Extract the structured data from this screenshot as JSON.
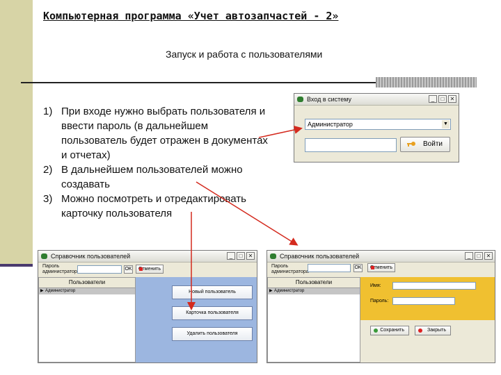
{
  "slide": {
    "title": "Компьютерная программа «Учет автозапчастей - 2»",
    "subtitle": "Запуск и работа с пользователями",
    "steps": [
      {
        "num": "1)",
        "text": "При входе нужно выбрать пользователя и ввести пароль (в дальнейшем пользователь будет отражен в документах и отчетах)"
      },
      {
        "num": "2)",
        "text": "В дальнейшем пользователей можно создавать"
      },
      {
        "num": "3)",
        "text": "Можно посмотреть и отредактировать карточку пользователя"
      }
    ]
  },
  "login_window": {
    "title": "Вход в систему",
    "user_combo_value": "Администратор",
    "enter_label": "Войти"
  },
  "window_controls": {
    "minimize": "_",
    "maximize": "□",
    "close": "✕"
  },
  "users_window_left": {
    "title": "Справочник пользователей",
    "password_label_1": "Пароль",
    "password_label_2": "администратора",
    "ok_label": "OK",
    "cancel_label": "Отменить",
    "list_header": "Пользователи",
    "row_1": "Администратор",
    "new_user_label": "Новый пользователь",
    "user_card_label": "Карточка пользователя",
    "delete_user_label": "Удалить пользователя"
  },
  "users_window_right": {
    "title": "Справочник пользователей",
    "password_label_1": "Пароль",
    "password_label_2": "администратора",
    "ok_label": "OK",
    "cancel_label": "Отменить",
    "list_header": "Пользователи",
    "row_1": "Администратор",
    "name_label": "Имя:",
    "password_field_label": "Пароль:",
    "save_label": "Сохранить",
    "close_label": "Закрыть"
  },
  "colors": {
    "side_bar": "#d7d4a6",
    "arrow": "#d42a1e",
    "blue_panel": "#9cb6e0",
    "yellow_panel": "#f0c030"
  }
}
